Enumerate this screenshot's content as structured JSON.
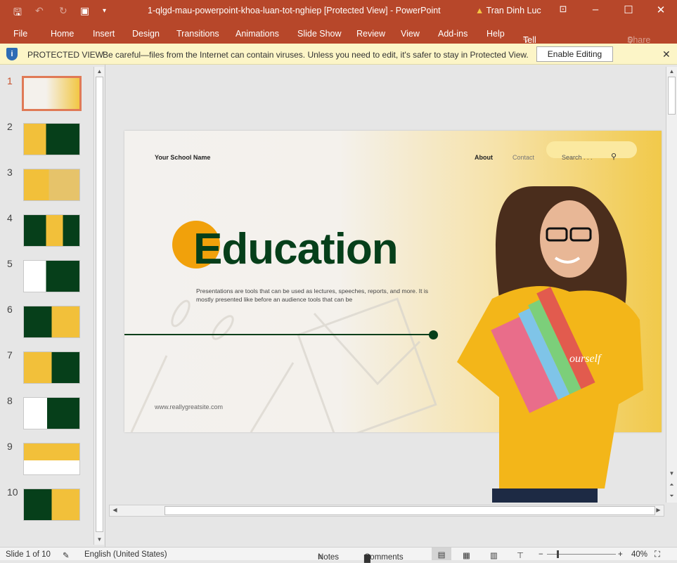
{
  "titlebar": {
    "title": "1-qlgd-mau-powerpoint-khoa-luan-tot-nghiep [Protected View]  -  PowerPoint",
    "user": "Tran Dinh Luc"
  },
  "ribbon": {
    "tabs": [
      "File",
      "Home",
      "Insert",
      "Design",
      "Transitions",
      "Animations",
      "Slide Show",
      "Review",
      "View",
      "Add-ins",
      "Help",
      "Tell me",
      "Share"
    ]
  },
  "protected": {
    "label": "PROTECTED VIEW",
    "message": "Be careful—files from the Internet can contain viruses. Unless you need to edit, it's safer to stay in Protected View.",
    "button": "Enable Editing"
  },
  "thumbnails": {
    "numbers": [
      "1",
      "2",
      "3",
      "4",
      "5",
      "6",
      "7",
      "8",
      "9",
      "10"
    ],
    "selected": 1
  },
  "slide": {
    "school": "Your School Name",
    "nav_about": "About",
    "nav_contact": "Contact",
    "search": "Search . . .",
    "title": "Education",
    "body": "Presentations are tools that can be used as lectures, speeches, reports, and more. It is mostly presented like before an audience tools that can be",
    "website": "www.reallygreatsite.com",
    "colors": {
      "green": "#063f1a",
      "orange": "#f1a10b",
      "yellow": "#f2c744"
    }
  },
  "status": {
    "slide": "Slide 1 of 10",
    "language": "English (United States)",
    "notes": "Notes",
    "comments": "Comments",
    "zoom": "40%"
  }
}
